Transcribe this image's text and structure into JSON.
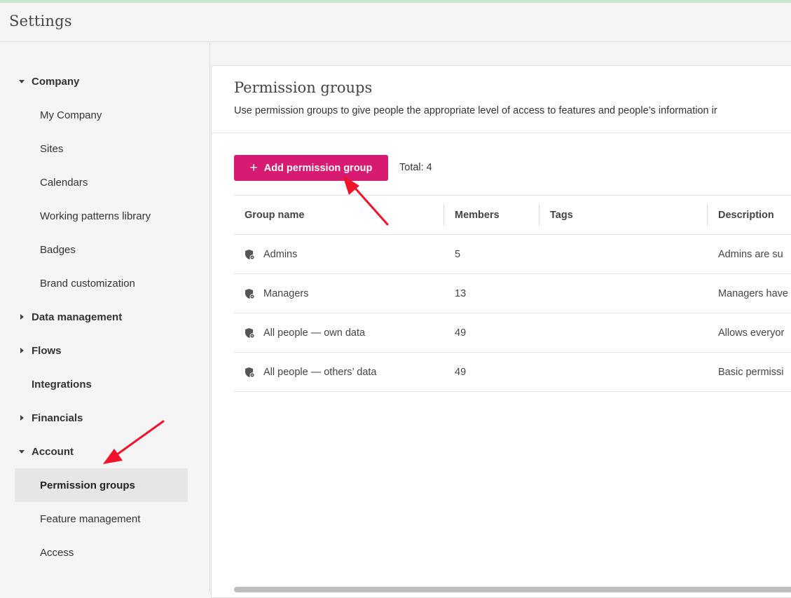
{
  "app": {
    "title": "Settings"
  },
  "sidebar": {
    "items": [
      {
        "label": "Company",
        "type": "section",
        "expanded": true
      },
      {
        "label": "My Company",
        "type": "child"
      },
      {
        "label": "Sites",
        "type": "child"
      },
      {
        "label": "Calendars",
        "type": "child"
      },
      {
        "label": "Working patterns library",
        "type": "child"
      },
      {
        "label": "Badges",
        "type": "child"
      },
      {
        "label": "Brand customization",
        "type": "child"
      },
      {
        "label": "Data management",
        "type": "section",
        "expanded": false
      },
      {
        "label": "Flows",
        "type": "section",
        "expanded": false
      },
      {
        "label": "Integrations",
        "type": "section-plain"
      },
      {
        "label": "Financials",
        "type": "section",
        "expanded": false
      },
      {
        "label": "Account",
        "type": "section",
        "expanded": true
      },
      {
        "label": "Permission groups",
        "type": "child",
        "active": true
      },
      {
        "label": "Feature management",
        "type": "child"
      },
      {
        "label": "Access",
        "type": "child"
      }
    ]
  },
  "main": {
    "title": "Permission groups",
    "description": "Use permission groups to give people the appropriate level of access to features and people’s information ir",
    "add_button_label": "Add permission group",
    "total_label": "Total: 4",
    "table": {
      "columns": [
        "Group name",
        "Members",
        "Tags",
        "Description"
      ],
      "rows": [
        {
          "name": "Admins",
          "members": "5",
          "tags": "",
          "description": "Admins are su"
        },
        {
          "name": "Managers",
          "members": "13",
          "tags": "",
          "description": "Managers have"
        },
        {
          "name": "All people — own data",
          "members": "49",
          "tags": "",
          "description": "Allows everyor"
        },
        {
          "name": "All people — others’ data",
          "members": "49",
          "tags": "",
          "description": "Basic permissi"
        }
      ]
    }
  },
  "colors": {
    "accent": "#d81b72",
    "annotation_arrow": "#f0132a"
  }
}
